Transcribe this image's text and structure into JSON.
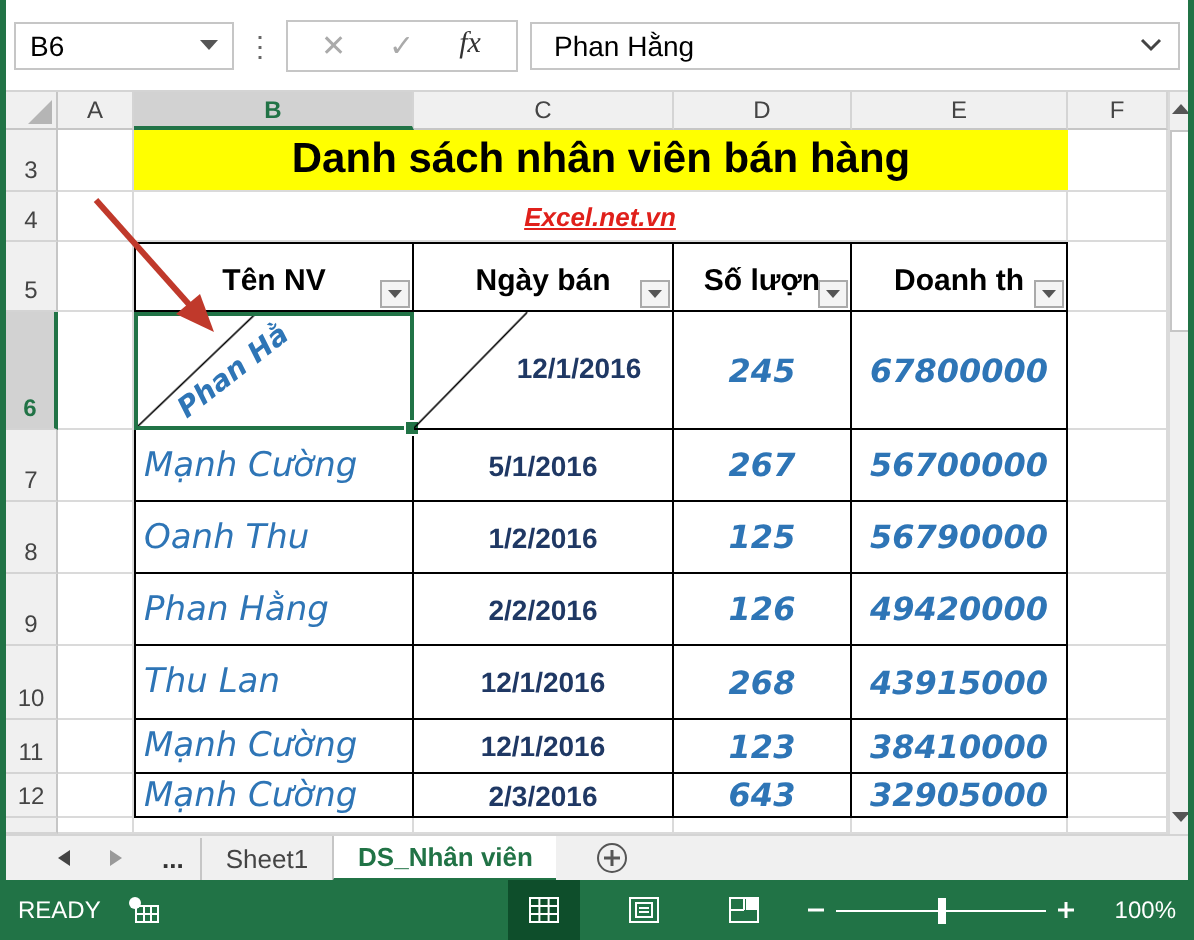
{
  "formula_bar": {
    "name_box": "B6",
    "more": "⋮",
    "cancel": "✕",
    "enter": "✓",
    "function_label": "fx",
    "formula": "Phan Hằng"
  },
  "columns": [
    {
      "label": "A",
      "selected": false
    },
    {
      "label": "B",
      "selected": true
    },
    {
      "label": "C",
      "selected": false
    },
    {
      "label": "D",
      "selected": false
    },
    {
      "label": "E",
      "selected": false
    },
    {
      "label": "F",
      "selected": false
    }
  ],
  "row_headers": [
    {
      "label": "3",
      "selected": false
    },
    {
      "label": "4",
      "selected": false
    },
    {
      "label": "5",
      "selected": false
    },
    {
      "label": "6",
      "selected": true
    },
    {
      "label": "7",
      "selected": false
    },
    {
      "label": "8",
      "selected": false
    },
    {
      "label": "9",
      "selected": false
    },
    {
      "label": "10",
      "selected": false
    },
    {
      "label": "11",
      "selected": false
    },
    {
      "label": "12",
      "selected": false
    }
  ],
  "title": "Danh sách nhân viên bán hàng",
  "link": "Excel.net.vn",
  "headers": [
    "Tên NV",
    "Ngày bán",
    "Số lượn",
    "Doanh th"
  ],
  "rows": [
    {
      "kind": "diagonal",
      "selected": true,
      "name": "Phan Hằ",
      "date": "12/1/2016",
      "quantity": "245",
      "revenue": "67800000"
    },
    {
      "kind": "plain",
      "selected": false,
      "name": "Mạnh Cường",
      "date": "5/1/2016",
      "quantity": "267",
      "revenue": "56700000"
    },
    {
      "kind": "plain",
      "selected": false,
      "name": "Oanh Thu",
      "date": "1/2/2016",
      "quantity": "125",
      "revenue": "56790000"
    },
    {
      "kind": "plain",
      "selected": false,
      "name": "Phan Hằng",
      "date": "2/2/2016",
      "quantity": "126",
      "revenue": "49420000"
    },
    {
      "kind": "plain",
      "selected": false,
      "name": "Thu Lan",
      "date": "12/1/2016",
      "quantity": "268",
      "revenue": "43915000"
    },
    {
      "kind": "plain",
      "selected": false,
      "name": "Mạnh Cường",
      "date": "12/1/2016",
      "quantity": "123",
      "revenue": "38410000"
    },
    {
      "kind": "plain",
      "selected": false,
      "name": "Mạnh Cường",
      "date": "2/3/2016",
      "quantity": "643",
      "revenue": "32905000"
    }
  ],
  "sheet_tabs": {
    "ellipsis": "...",
    "tabs": [
      {
        "label": "Sheet1",
        "selected": false
      },
      {
        "label": "DS_Nhân viên",
        "selected": true
      }
    ]
  },
  "status_bar": {
    "mode": "READY",
    "views": [
      {
        "kind": "normal",
        "selected": true
      },
      {
        "kind": "page_layout",
        "selected": false
      },
      {
        "kind": "page_break",
        "selected": false
      }
    ],
    "zoom": {
      "level": 0.5,
      "reading": "100%"
    }
  }
}
